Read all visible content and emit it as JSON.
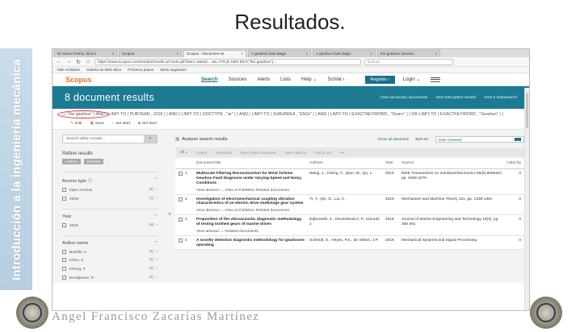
{
  "slide": {
    "title": "Resultados.",
    "side_text": "Introducción a la ingeniería mecánica",
    "author": "Angel Francisco Zacarías Martínez"
  },
  "browser": {
    "tabs": [
      {
        "label": "El nuevo Firefox, fácil d",
        "active": false
      },
      {
        "label": "Scopus",
        "active": false
      },
      {
        "label": "Scopus - Document se",
        "active": true
      },
      {
        "label": "A gearbox fault diagn",
        "active": false
      },
      {
        "label": "A gearbox fault diagn",
        "active": false
      },
      {
        "label": "the gearbox (section",
        "active": false
      }
    ],
    "url": "https://www.scopus.com/results/results.uri?sort=plf-f&src=s&sid=...&s=TITLE-ABS-KEY(\"the gearbox\")...",
    "search_placeholder": "Buscar",
    "bookmarks": [
      "Más visitados",
      "Galería de Web Slice",
      "Primeros pasos",
      "Sitios sugeridos"
    ]
  },
  "scopus": {
    "logo": "Scopus",
    "nav": [
      "Search",
      "Sources",
      "Alerts",
      "Lists",
      "Help ⌄",
      "SciVal ›"
    ],
    "register": "Register ›",
    "login": "Login ⌄",
    "results_title": "8 document results",
    "banner_links": [
      "View secondary documents",
      "View 540 patent results",
      "View 2 DataSearch"
    ],
    "query_text": "( ( \"the gearbox\" ) AND ( LIMIT-TO ( PUBYEAR , 2018 ) ) AND ( LIMIT-TO ( DOCTYPE , \"ar\" ) ) AND ( LIMIT-TO ( SUBJAREA , \"ENGI\" ) ) AND ( LIMIT-TO ( EXACTKEYWORD , \"Gears\" ) ) OR LIMIT-TO ( EXACTKEYWORD , \"Gearbox\" ) )",
    "actions": [
      {
        "icon": "pencil-icon",
        "glyph": "✎",
        "label": "Edit"
      },
      {
        "icon": "save-icon",
        "glyph": "▣",
        "label": "Save"
      },
      {
        "icon": "bell-icon",
        "glyph": "♪",
        "label": "Set alert"
      },
      {
        "icon": "rss-icon",
        "glyph": "◙",
        "label": "Set feed"
      }
    ],
    "sidebar": {
      "search_placeholder": "Search within results...",
      "refine_title": "Refine results",
      "limit_to": "Limit to",
      "exclude": "Exclude",
      "facets": [
        {
          "title": "Access type ⓘ",
          "items": [
            {
              "label": "Open Access",
              "count": "(1)"
            },
            {
              "label": "Other",
              "count": "(7)"
            }
          ]
        },
        {
          "title": "Year",
          "items": [
            {
              "label": "2018",
              "count": "(8)"
            }
          ]
        },
        {
          "title": "Author name",
          "items": [
            {
              "label": "Bustillo, A.",
              "count": "(1)"
            },
            {
              "label": "Chen, S.",
              "count": "(1)"
            },
            {
              "label": "Cheng, F.",
              "count": "(1)"
            },
            {
              "label": "Dzusjkowiz, P.",
              "count": "(1)"
            }
          ]
        }
      ]
    },
    "main": {
      "analyze": "Analyze search results",
      "show_abstracts": "Show all abstracts",
      "sort_label": "Sort on:",
      "sort_value": "Date (newest)",
      "toolbar": [
        "All ⌄",
        "Export",
        "Download",
        "View citation overview",
        "View cited by",
        "Add to List",
        "•••"
      ],
      "columns": [
        "Document title",
        "Authors",
        "Year",
        "Source",
        "Cited by"
      ],
      "rows": [
        {
          "num": "1",
          "title": "Multiscale Filtering Reconstruction for Wind Turbine Gearbox Fault Diagnosis under Varying-Speed and Noisy Conditions",
          "authors": "Wang, J., Cheng, F., Qiao, W., Qu, L.",
          "year": "2018",
          "source": "IEEE Transactions on Industrial Electronics 65(5),8086167, pp. 4268-4278",
          "cited": "0",
          "links": "View abstract ⌄  View at Publisher  Related documents"
        },
        {
          "num": "2",
          "title": "Investigation of electromechanical coupling vibration characteristics of an electric drive multistage gear system",
          "authors": "Yi, Y., Qin, D., Liu, C.",
          "year": "2018",
          "source": "Mechanism and Machine Theory 121, pp. 1339-1351",
          "cited": "0",
          "links": "View abstract ⌄  View at Publisher  Related documents"
        },
        {
          "num": "3",
          "title": "Proposition of the vibroacoustic diagnostic methodology of testing toothed gears of marine drives",
          "authors": "Dąbrowski, Z., Deuszkiewicz, P., Dziurdź, J.",
          "year": "2018",
          "source": "Journal of Marine Engineering and Technology 16(4), pp. 386-391",
          "cited": "0",
          "links": "View abstract ⌄  Related documents"
        },
        {
          "num": "4",
          "title": "A novelty detection diagnostic methodology for gearboxes operating",
          "authors": "Schmidt, S., Heyns, P.S., de Villiers, J.P.",
          "year": "2018",
          "source": "Mechanical Systems and Signal Processing",
          "cited": "0",
          "links": ""
        }
      ]
    }
  }
}
